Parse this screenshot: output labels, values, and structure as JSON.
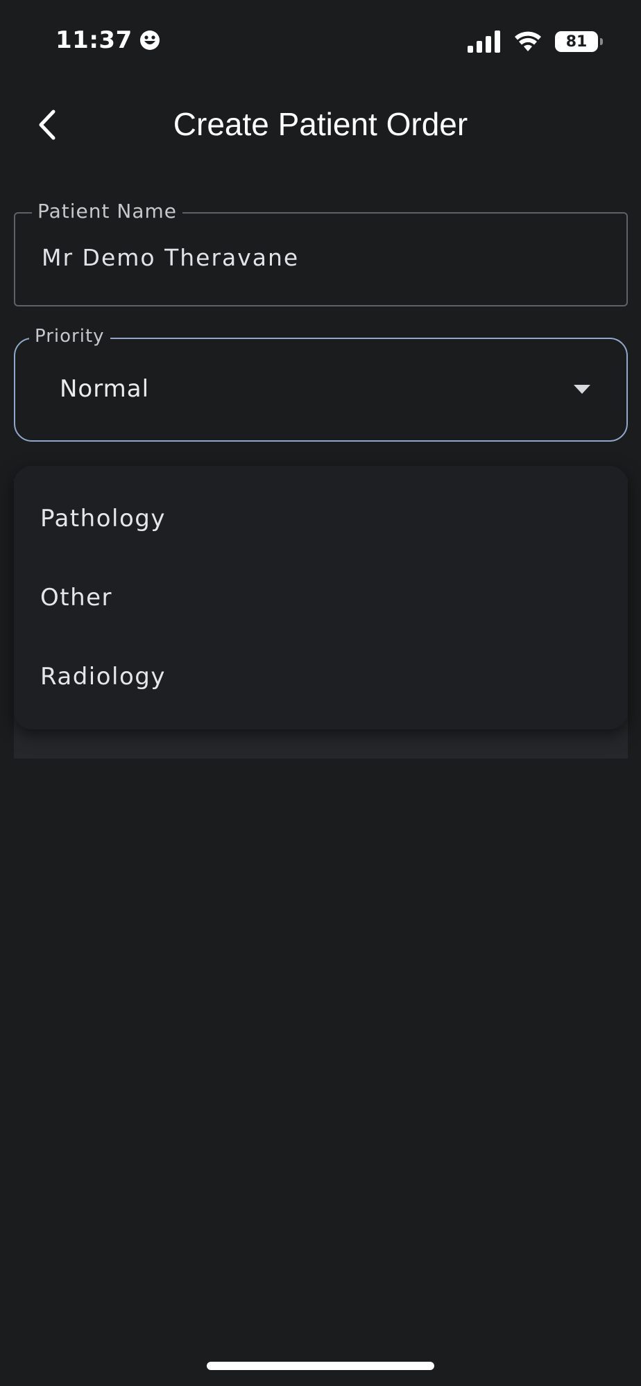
{
  "status_bar": {
    "time": "11:37",
    "battery_level": "81",
    "icons": [
      "smiley-icon",
      "cellular-signal-icon",
      "wifi-icon",
      "battery-icon"
    ]
  },
  "app_bar": {
    "title": "Create Patient Order",
    "back_icon": "chevron-left-icon"
  },
  "form": {
    "patient_name": {
      "label": "Patient Name",
      "value": "Mr Demo Theravane"
    },
    "priority": {
      "label": "Priority",
      "value": "Normal",
      "icon": "dropdown-arrow-icon"
    }
  },
  "menu": {
    "items": [
      {
        "label": "Pathology"
      },
      {
        "label": "Other"
      },
      {
        "label": "Radiology"
      }
    ]
  },
  "colors": {
    "background": "#1b1c1e",
    "accent": "#8fa8cc",
    "button_accent": "#7c95bc",
    "text": "#e6e6e8"
  }
}
